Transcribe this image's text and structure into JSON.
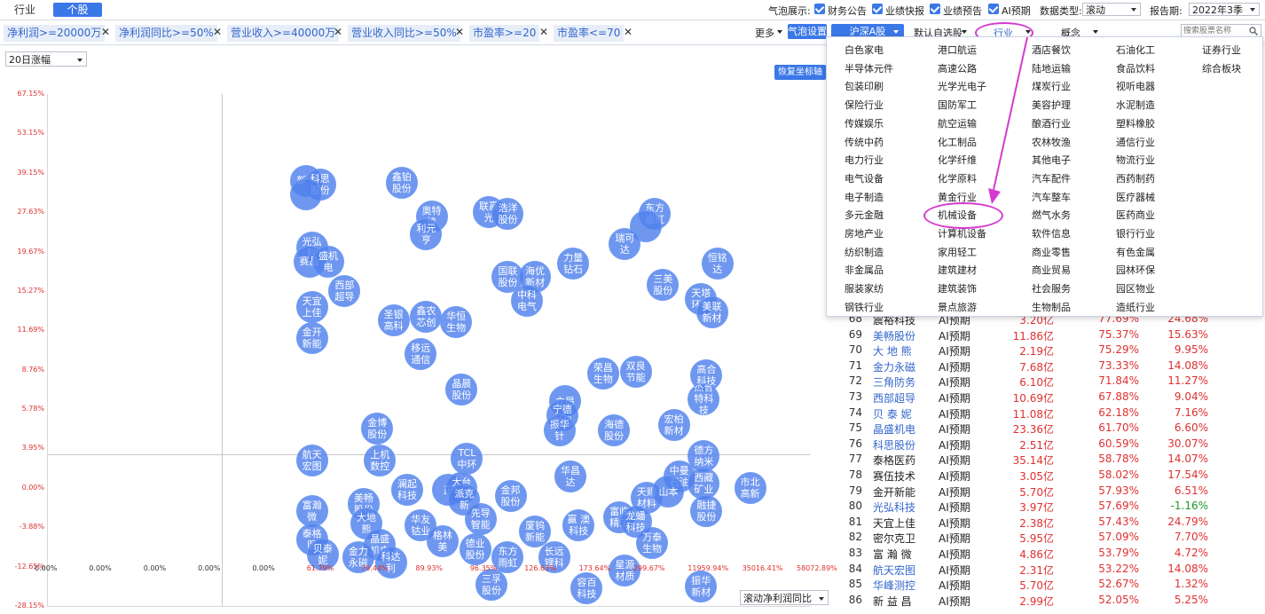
{
  "tabs": {
    "industry": "行业",
    "stock": "个股"
  },
  "bubble_display": {
    "label": "气泡展示:",
    "options": [
      "财务公告",
      "业绩快报",
      "业绩预告",
      "AI预期"
    ]
  },
  "data_type": {
    "label": "数据类型:",
    "value": "滚动"
  },
  "report_period": {
    "label": "报告期:",
    "value": "2022年3季"
  },
  "filters": [
    "净利润>=20000万",
    "净利润同比>=50%",
    "营业收入>=40000万",
    "营业收入同比>=50%",
    "市盈率>=20",
    "市盈率<=70"
  ],
  "toolbar": {
    "more": "更多",
    "bubble_settings": "气泡设置",
    "market": "沪深A股",
    "default_watchlist": "默认自选股",
    "industry": "行业",
    "concept": "概念",
    "search_placeholder": "搜索股票名称"
  },
  "chart_controls": {
    "y_select": "20日涨幅",
    "restore_axis": "恢复坐标轴",
    "x_select": "滚动净利润同比"
  },
  "colors": {
    "accent": "#3b78e7",
    "bubble": "#4f80ec",
    "positive": "#e03030",
    "negative": "#1a9a2a",
    "highlight": "#d63ad0"
  },
  "chart_data": {
    "type": "scatter",
    "y_axis_label": "20日涨幅",
    "x_axis_label": "滚动净利润同比",
    "y_ticks": [
      "67.15%",
      "53.15%",
      "39.15%",
      "27.63%",
      "19.67%",
      "15.27%",
      "11.69%",
      "8.76%",
      "5.78%",
      "3.95%",
      "0.00%",
      "-3.88%",
      "-12.65%",
      "-28.15%"
    ],
    "x_ticks": [
      "0.00%",
      "0.00%",
      "0.00%",
      "0.00%",
      "0.00%",
      "61.79%",
      "79.44%",
      "89.93%",
      "96.35%",
      "126.63%",
      "173.64%",
      "299.67%",
      "11959.94%",
      "35016.41%",
      "58072.89%"
    ],
    "x_tick_colors": [
      "black",
      "black",
      "black",
      "black",
      "black",
      "red",
      "red",
      "red",
      "red",
      "red",
      "red",
      "red",
      "red",
      "red",
      "red"
    ],
    "points": [
      {
        "label": "新华",
        "xi": 4.75,
        "yi": 2.2
      },
      {
        "label": "科思股份",
        "xi": 5.0,
        "yi": 2.3
      },
      {
        "label": "",
        "xi": 4.75,
        "yi": 2.55
      },
      {
        "label": "鑫铂股份",
        "xi": 6.5,
        "yi": 2.25
      },
      {
        "label": "奥特维",
        "xi": 7.05,
        "yi": 3.1
      },
      {
        "label": "利元亨",
        "xi": 6.95,
        "yi": 3.55
      },
      {
        "label": "联赢光",
        "xi": 8.1,
        "yi": 3.0
      },
      {
        "label": "浩洋股份",
        "xi": 8.45,
        "yi": 3.05
      },
      {
        "label": "东方嘉虹",
        "xi": 11.15,
        "yi": 3.05
      },
      {
        "label": "",
        "xi": 10.98,
        "yi": 3.35
      },
      {
        "label": "瑞可达",
        "xi": 10.6,
        "yi": 3.8
      },
      {
        "label": "光弘科",
        "xi": 4.85,
        "yi": 3.9
      },
      {
        "label": "赛晶",
        "xi": 4.8,
        "yi": 4.25
      },
      {
        "label": "盛机电",
        "xi": 5.15,
        "yi": 4.25
      },
      {
        "label": "力量钻石",
        "xi": 9.65,
        "yi": 4.3
      },
      {
        "label": "恒铭达",
        "xi": 12.3,
        "yi": 4.3
      },
      {
        "label": "国联股份",
        "xi": 8.45,
        "yi": 4.65
      },
      {
        "label": "海优新材",
        "xi": 8.95,
        "yi": 4.65
      },
      {
        "label": "中科电气",
        "xi": 8.8,
        "yi": 5.25
      },
      {
        "label": "三美股份",
        "xi": 11.3,
        "yi": 4.85
      },
      {
        "label": "西部超导",
        "xi": 5.45,
        "yi": 5.0
      },
      {
        "label": "天宜上佳",
        "xi": 4.85,
        "yi": 5.4
      },
      {
        "label": "天塔环境",
        "xi": 12.0,
        "yi": 5.2
      },
      {
        "label": "美联新材",
        "xi": 12.2,
        "yi": 5.55
      },
      {
        "label": "圣银高科",
        "xi": 6.35,
        "yi": 5.75
      },
      {
        "label": "鑫农芯创",
        "xi": 6.95,
        "yi": 5.65
      },
      {
        "label": "华恒生物",
        "xi": 7.5,
        "yi": 5.8
      },
      {
        "label": "金开新能",
        "xi": 4.85,
        "yi": 6.2
      },
      {
        "label": "移远通信",
        "xi": 6.85,
        "yi": 6.6
      },
      {
        "label": "荣昌生物",
        "xi": 10.2,
        "yi": 7.1
      },
      {
        "label": "双良节能",
        "xi": 10.8,
        "yi": 7.05
      },
      {
        "label": "晶晨股份",
        "xi": 7.6,
        "yi": 7.5
      },
      {
        "label": "高合科技",
        "xi": 12.1,
        "yi": 7.15
      },
      {
        "label": "立昂",
        "xi": 9.5,
        "yi": 7.8
      },
      {
        "label": "宁德时代",
        "xi": 9.45,
        "yi": 8.15
      },
      {
        "label": "振华针",
        "xi": 9.4,
        "yi": 8.55
      },
      {
        "label": "海德股份",
        "xi": 10.4,
        "yi": 8.55
      },
      {
        "label": "宏柏新材",
        "xi": 11.5,
        "yi": 8.4
      },
      {
        "label": "杰普特科技",
        "xi": 12.05,
        "yi": 7.75
      },
      {
        "label": "金博股份",
        "xi": 6.05,
        "yi": 8.5
      },
      {
        "label": "航天宏图",
        "xi": 4.85,
        "yi": 9.3
      },
      {
        "label": "上机数控",
        "xi": 6.1,
        "yi": 9.3
      },
      {
        "label": "TCL中环",
        "xi": 7.7,
        "yi": 9.25
      },
      {
        "label": "德方纳米",
        "xi": 12.05,
        "yi": 9.2
      },
      {
        "label": "华昌达",
        "xi": 9.6,
        "yi": 9.7
      },
      {
        "label": "中曼石油",
        "xi": 11.6,
        "yi": 9.7
      },
      {
        "label": "西藏矿业",
        "xi": 12.05,
        "yi": 9.9
      },
      {
        "label": "市北高新",
        "xi": 12.9,
        "yi": 10.0
      },
      {
        "label": "澜起科技",
        "xi": 6.6,
        "yi": 10.05
      },
      {
        "label": "正",
        "xi": 7.35,
        "yi": 10.05
      },
      {
        "label": "大台光",
        "xi": 7.6,
        "yi": 10.0
      },
      {
        "label": "派克新",
        "xi": 7.65,
        "yi": 10.3
      },
      {
        "label": "金邦股份",
        "xi": 8.5,
        "yi": 10.2
      },
      {
        "label": "天赐材料",
        "xi": 11.0,
        "yi": 10.25
      },
      {
        "label": "山本",
        "xi": 11.4,
        "yi": 10.1
      },
      {
        "label": "融捷股份",
        "xi": 12.1,
        "yi": 10.6
      },
      {
        "label": "富瀚微",
        "xi": 4.85,
        "yi": 10.6
      },
      {
        "label": "美畅股份",
        "xi": 5.8,
        "yi": 10.4
      },
      {
        "label": "大地熊",
        "xi": 5.85,
        "yi": 10.9
      },
      {
        "label": "先导智能",
        "xi": 7.95,
        "yi": 10.8
      },
      {
        "label": "华友钴业",
        "xi": 6.85,
        "yi": 10.95
      },
      {
        "label": "格林美",
        "xi": 7.25,
        "yi": 11.35
      },
      {
        "label": "赢 澳科技",
        "xi": 9.75,
        "yi": 10.95
      },
      {
        "label": "厦钨新能",
        "xi": 8.95,
        "yi": 11.1
      },
      {
        "label": "富临精工",
        "xi": 10.5,
        "yi": 10.75
      },
      {
        "label": "龙蟠科技",
        "xi": 10.8,
        "yi": 10.85
      },
      {
        "label": "万泰生物",
        "xi": 11.1,
        "yi": 11.4
      },
      {
        "label": "泰格医",
        "xi": 4.85,
        "yi": 11.3
      },
      {
        "label": "贝泰妮",
        "xi": 5.05,
        "yi": 11.7
      },
      {
        "label": "晶盛机电",
        "xi": 6.1,
        "yi": 11.45
      },
      {
        "label": "金力永磁",
        "xi": 5.7,
        "yi": 11.75
      },
      {
        "label": "科达利",
        "xi": 6.3,
        "yi": 11.9
      },
      {
        "label": "德业股份",
        "xi": 7.85,
        "yi": 11.55
      },
      {
        "label": "东方雨虹",
        "xi": 8.45,
        "yi": 11.75
      },
      {
        "label": "长远锂科",
        "xi": 9.3,
        "yi": 11.75
      },
      {
        "label": "星源材质",
        "xi": 10.6,
        "yi": 12.1
      },
      {
        "label": "三孚股份",
        "xi": 8.15,
        "yi": 12.45
      },
      {
        "label": "容百科技",
        "xi": 9.9,
        "yi": 12.55
      },
      {
        "label": "振华新材",
        "xi": 12.0,
        "yi": 12.5
      }
    ]
  },
  "industry_panel": {
    "columns": [
      [
        "白色家电",
        "半导体元件",
        "包装印刷",
        "保险行业",
        "传媒娱乐",
        "传统中药",
        "电力行业",
        "电气设备",
        "电子制造",
        "多元金融",
        "房地产业",
        "纺织制造",
        "非金属品",
        "服装家纺",
        "钢铁行业"
      ],
      [
        "港口航运",
        "高速公路",
        "光学光电子",
        "国防军工",
        "航空运输",
        "化工制品",
        "化学纤维",
        "化学原料",
        "黄金行业",
        "机械设备",
        "计算机设备",
        "家用轻工",
        "建筑建材",
        "建筑装饰",
        "景点旅游"
      ],
      [
        "酒店餐饮",
        "陆地运输",
        "煤炭行业",
        "美容护理",
        "酿酒行业",
        "农林牧渔",
        "其他电子",
        "汽车配件",
        "汽车整车",
        "燃气水务",
        "软件信息",
        "商业零售",
        "商业贸易",
        "社会服务",
        "生物制品"
      ],
      [
        "石油化工",
        "食品饮料",
        "视听电器",
        "水泥制造",
        "塑料橡胶",
        "通信行业",
        "物流行业",
        "西药制药",
        "医疗器械",
        "医药商业",
        "银行行业",
        "有色金属",
        "园林环保",
        "园区物业",
        "造纸行业"
      ],
      [
        "证券行业",
        "综合板块"
      ]
    ]
  },
  "table": {
    "rows": [
      {
        "idx": "68",
        "name": "震裕科技",
        "blue": false,
        "src": "AI预期",
        "v1": "3.20亿",
        "v2": "77.69%",
        "v3": "24.68%",
        "neg": false
      },
      {
        "idx": "69",
        "name": "美畅股份",
        "blue": true,
        "src": "AI预期",
        "v1": "11.86亿",
        "v2": "75.37%",
        "v3": "15.63%",
        "neg": false
      },
      {
        "idx": "70",
        "name": "大 地 熊",
        "blue": true,
        "src": "AI预期",
        "v1": "2.19亿",
        "v2": "75.29%",
        "v3": "9.95%",
        "neg": false
      },
      {
        "idx": "71",
        "name": "金力永磁",
        "blue": true,
        "src": "AI预期",
        "v1": "7.68亿",
        "v2": "73.33%",
        "v3": "14.08%",
        "neg": false
      },
      {
        "idx": "72",
        "name": "三角防务",
        "blue": true,
        "src": "AI预期",
        "v1": "6.10亿",
        "v2": "71.84%",
        "v3": "11.27%",
        "neg": false
      },
      {
        "idx": "73",
        "name": "西部超导",
        "blue": true,
        "src": "AI预期",
        "v1": "10.69亿",
        "v2": "67.88%",
        "v3": "9.04%",
        "neg": false
      },
      {
        "idx": "74",
        "name": "贝 泰 妮",
        "blue": true,
        "src": "AI预期",
        "v1": "11.08亿",
        "v2": "62.18%",
        "v3": "7.16%",
        "neg": false
      },
      {
        "idx": "75",
        "name": "晶盛机电",
        "blue": true,
        "src": "AI预期",
        "v1": "23.36亿",
        "v2": "61.70%",
        "v3": "6.60%",
        "neg": false
      },
      {
        "idx": "76",
        "name": "科思股份",
        "blue": true,
        "src": "AI预期",
        "v1": "2.51亿",
        "v2": "60.59%",
        "v3": "30.07%",
        "neg": false
      },
      {
        "idx": "77",
        "name": "泰格医药",
        "blue": false,
        "src": "AI预期",
        "v1": "35.14亿",
        "v2": "58.78%",
        "v3": "14.07%",
        "neg": false
      },
      {
        "idx": "78",
        "name": "赛伍技术",
        "blue": false,
        "src": "AI预期",
        "v1": "3.05亿",
        "v2": "58.02%",
        "v3": "17.54%",
        "neg": false
      },
      {
        "idx": "79",
        "name": "金开新能",
        "blue": false,
        "src": "AI预期",
        "v1": "5.70亿",
        "v2": "57.93%",
        "v3": "6.51%",
        "neg": false
      },
      {
        "idx": "80",
        "name": "光弘科技",
        "blue": true,
        "src": "AI预期",
        "v1": "3.97亿",
        "v2": "57.69%",
        "v3": "-1.16%",
        "neg": true
      },
      {
        "idx": "81",
        "name": "天宜上佳",
        "blue": false,
        "src": "AI预期",
        "v1": "2.38亿",
        "v2": "57.43%",
        "v3": "24.79%",
        "neg": false
      },
      {
        "idx": "82",
        "name": "密尔克卫",
        "blue": false,
        "src": "AI预期",
        "v1": "5.95亿",
        "v2": "57.09%",
        "v3": "7.70%",
        "neg": false
      },
      {
        "idx": "83",
        "name": "富 瀚 微",
        "blue": false,
        "src": "AI预期",
        "v1": "4.86亿",
        "v2": "53.79%",
        "v3": "4.72%",
        "neg": false
      },
      {
        "idx": "84",
        "name": "航天宏图",
        "blue": true,
        "src": "AI预期",
        "v1": "2.31亿",
        "v2": "53.22%",
        "v3": "14.08%",
        "neg": false
      },
      {
        "idx": "85",
        "name": "华峰测控",
        "blue": true,
        "src": "AI预期",
        "v1": "5.70亿",
        "v2": "52.67%",
        "v3": "1.32%",
        "neg": false
      },
      {
        "idx": "86",
        "name": "新 益 昌",
        "blue": false,
        "src": "AI预期",
        "v1": "2.99亿",
        "v2": "52.05%",
        "v3": "5.25%",
        "neg": false
      }
    ]
  }
}
